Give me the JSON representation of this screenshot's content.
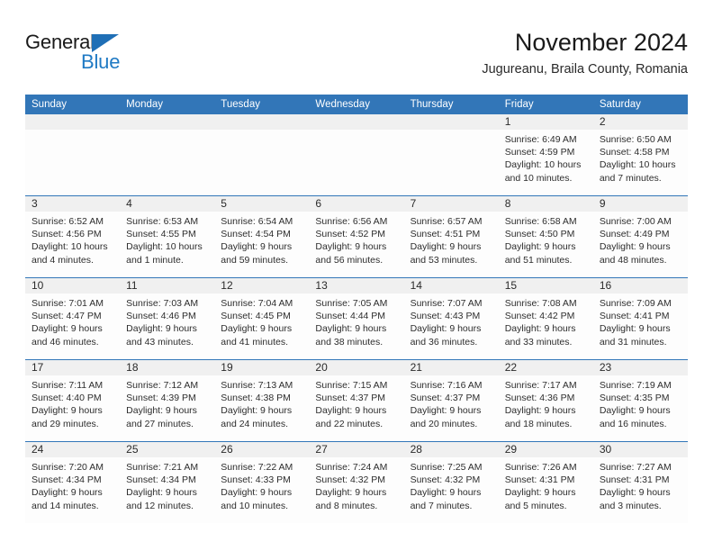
{
  "brand": {
    "name_top": "General",
    "name_bottom": "Blue",
    "accent_color": "#1f7ac4",
    "triangle_icon": "triangle-right-icon"
  },
  "header": {
    "title": "November 2024",
    "subtitle": "Jugureanu, Braila County, Romania"
  },
  "calendar": {
    "header_bg": "#3276b8",
    "date_band_bg": "#f0f0f0",
    "weekdays": [
      "Sunday",
      "Monday",
      "Tuesday",
      "Wednesday",
      "Thursday",
      "Friday",
      "Saturday"
    ],
    "weeks": [
      [
        {
          "day": "",
          "empty": true
        },
        {
          "day": "",
          "empty": true
        },
        {
          "day": "",
          "empty": true
        },
        {
          "day": "",
          "empty": true
        },
        {
          "day": "",
          "empty": true
        },
        {
          "day": "1",
          "sunrise": "Sunrise: 6:49 AM",
          "sunset": "Sunset: 4:59 PM",
          "daylight1": "Daylight: 10 hours",
          "daylight2": "and 10 minutes."
        },
        {
          "day": "2",
          "sunrise": "Sunrise: 6:50 AM",
          "sunset": "Sunset: 4:58 PM",
          "daylight1": "Daylight: 10 hours",
          "daylight2": "and 7 minutes."
        }
      ],
      [
        {
          "day": "3",
          "sunrise": "Sunrise: 6:52 AM",
          "sunset": "Sunset: 4:56 PM",
          "daylight1": "Daylight: 10 hours",
          "daylight2": "and 4 minutes."
        },
        {
          "day": "4",
          "sunrise": "Sunrise: 6:53 AM",
          "sunset": "Sunset: 4:55 PM",
          "daylight1": "Daylight: 10 hours",
          "daylight2": "and 1 minute."
        },
        {
          "day": "5",
          "sunrise": "Sunrise: 6:54 AM",
          "sunset": "Sunset: 4:54 PM",
          "daylight1": "Daylight: 9 hours",
          "daylight2": "and 59 minutes."
        },
        {
          "day": "6",
          "sunrise": "Sunrise: 6:56 AM",
          "sunset": "Sunset: 4:52 PM",
          "daylight1": "Daylight: 9 hours",
          "daylight2": "and 56 minutes."
        },
        {
          "day": "7",
          "sunrise": "Sunrise: 6:57 AM",
          "sunset": "Sunset: 4:51 PM",
          "daylight1": "Daylight: 9 hours",
          "daylight2": "and 53 minutes."
        },
        {
          "day": "8",
          "sunrise": "Sunrise: 6:58 AM",
          "sunset": "Sunset: 4:50 PM",
          "daylight1": "Daylight: 9 hours",
          "daylight2": "and 51 minutes."
        },
        {
          "day": "9",
          "sunrise": "Sunrise: 7:00 AM",
          "sunset": "Sunset: 4:49 PM",
          "daylight1": "Daylight: 9 hours",
          "daylight2": "and 48 minutes."
        }
      ],
      [
        {
          "day": "10",
          "sunrise": "Sunrise: 7:01 AM",
          "sunset": "Sunset: 4:47 PM",
          "daylight1": "Daylight: 9 hours",
          "daylight2": "and 46 minutes."
        },
        {
          "day": "11",
          "sunrise": "Sunrise: 7:03 AM",
          "sunset": "Sunset: 4:46 PM",
          "daylight1": "Daylight: 9 hours",
          "daylight2": "and 43 minutes."
        },
        {
          "day": "12",
          "sunrise": "Sunrise: 7:04 AM",
          "sunset": "Sunset: 4:45 PM",
          "daylight1": "Daylight: 9 hours",
          "daylight2": "and 41 minutes."
        },
        {
          "day": "13",
          "sunrise": "Sunrise: 7:05 AM",
          "sunset": "Sunset: 4:44 PM",
          "daylight1": "Daylight: 9 hours",
          "daylight2": "and 38 minutes."
        },
        {
          "day": "14",
          "sunrise": "Sunrise: 7:07 AM",
          "sunset": "Sunset: 4:43 PM",
          "daylight1": "Daylight: 9 hours",
          "daylight2": "and 36 minutes."
        },
        {
          "day": "15",
          "sunrise": "Sunrise: 7:08 AM",
          "sunset": "Sunset: 4:42 PM",
          "daylight1": "Daylight: 9 hours",
          "daylight2": "and 33 minutes."
        },
        {
          "day": "16",
          "sunrise": "Sunrise: 7:09 AM",
          "sunset": "Sunset: 4:41 PM",
          "daylight1": "Daylight: 9 hours",
          "daylight2": "and 31 minutes."
        }
      ],
      [
        {
          "day": "17",
          "sunrise": "Sunrise: 7:11 AM",
          "sunset": "Sunset: 4:40 PM",
          "daylight1": "Daylight: 9 hours",
          "daylight2": "and 29 minutes."
        },
        {
          "day": "18",
          "sunrise": "Sunrise: 7:12 AM",
          "sunset": "Sunset: 4:39 PM",
          "daylight1": "Daylight: 9 hours",
          "daylight2": "and 27 minutes."
        },
        {
          "day": "19",
          "sunrise": "Sunrise: 7:13 AM",
          "sunset": "Sunset: 4:38 PM",
          "daylight1": "Daylight: 9 hours",
          "daylight2": "and 24 minutes."
        },
        {
          "day": "20",
          "sunrise": "Sunrise: 7:15 AM",
          "sunset": "Sunset: 4:37 PM",
          "daylight1": "Daylight: 9 hours",
          "daylight2": "and 22 minutes."
        },
        {
          "day": "21",
          "sunrise": "Sunrise: 7:16 AM",
          "sunset": "Sunset: 4:37 PM",
          "daylight1": "Daylight: 9 hours",
          "daylight2": "and 20 minutes."
        },
        {
          "day": "22",
          "sunrise": "Sunrise: 7:17 AM",
          "sunset": "Sunset: 4:36 PM",
          "daylight1": "Daylight: 9 hours",
          "daylight2": "and 18 minutes."
        },
        {
          "day": "23",
          "sunrise": "Sunrise: 7:19 AM",
          "sunset": "Sunset: 4:35 PM",
          "daylight1": "Daylight: 9 hours",
          "daylight2": "and 16 minutes."
        }
      ],
      [
        {
          "day": "24",
          "sunrise": "Sunrise: 7:20 AM",
          "sunset": "Sunset: 4:34 PM",
          "daylight1": "Daylight: 9 hours",
          "daylight2": "and 14 minutes."
        },
        {
          "day": "25",
          "sunrise": "Sunrise: 7:21 AM",
          "sunset": "Sunset: 4:34 PM",
          "daylight1": "Daylight: 9 hours",
          "daylight2": "and 12 minutes."
        },
        {
          "day": "26",
          "sunrise": "Sunrise: 7:22 AM",
          "sunset": "Sunset: 4:33 PM",
          "daylight1": "Daylight: 9 hours",
          "daylight2": "and 10 minutes."
        },
        {
          "day": "27",
          "sunrise": "Sunrise: 7:24 AM",
          "sunset": "Sunset: 4:32 PM",
          "daylight1": "Daylight: 9 hours",
          "daylight2": "and 8 minutes."
        },
        {
          "day": "28",
          "sunrise": "Sunrise: 7:25 AM",
          "sunset": "Sunset: 4:32 PM",
          "daylight1": "Daylight: 9 hours",
          "daylight2": "and 7 minutes."
        },
        {
          "day": "29",
          "sunrise": "Sunrise: 7:26 AM",
          "sunset": "Sunset: 4:31 PM",
          "daylight1": "Daylight: 9 hours",
          "daylight2": "and 5 minutes."
        },
        {
          "day": "30",
          "sunrise": "Sunrise: 7:27 AM",
          "sunset": "Sunset: 4:31 PM",
          "daylight1": "Daylight: 9 hours",
          "daylight2": "and 3 minutes."
        }
      ]
    ]
  }
}
